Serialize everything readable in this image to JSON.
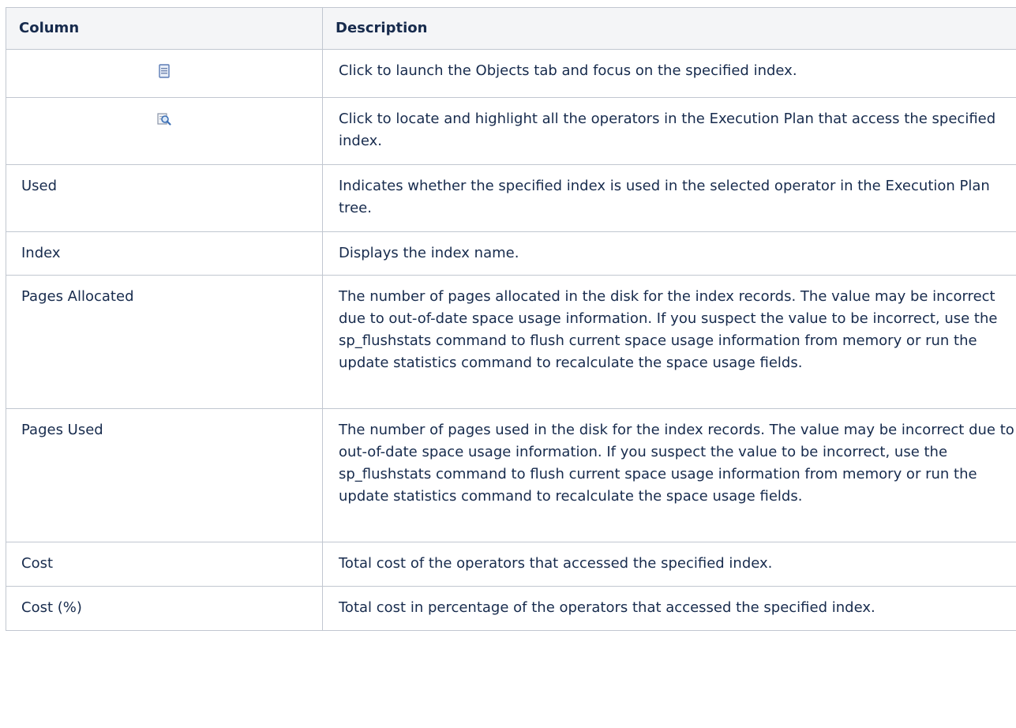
{
  "table": {
    "headers": {
      "column": "Column",
      "description": "Description"
    },
    "rows": [
      {
        "icon": "object-properties-icon",
        "description": "Click to launch the Objects tab and focus on the specified index."
      },
      {
        "icon": "locate-zoom-icon",
        "description": "Click to locate and highlight all the operators in the Execution Plan that access the specified index."
      },
      {
        "column": "Used",
        "description": "Indicates whether the specified index is used in the selected operator in the Execution Plan tree."
      },
      {
        "column": "Index",
        "description": "Displays the index name."
      },
      {
        "column": "Pages Allocated",
        "description": "The number of pages allocated in the disk for the index records. The value may be incorrect due to out-of-date space usage information. If you suspect the value to be incorrect, use the sp_flushstats command to flush current space usage information from memory or run the update statistics command to recalculate the space usage fields."
      },
      {
        "column": "Pages Used",
        "description": "The number of pages used in the disk for the index records. The value may be incorrect due to out-of-date space usage information. If you suspect the value to be incorrect, use the sp_flushstats command to flush current space usage information from memory or run the update statistics command to recalculate the space usage fields."
      },
      {
        "column": "Cost",
        "description": "Total cost of the operators that accessed the specified index."
      },
      {
        "column": "Cost (%)",
        "description": "Total cost in percentage of the operators that accessed the specified index."
      }
    ]
  }
}
